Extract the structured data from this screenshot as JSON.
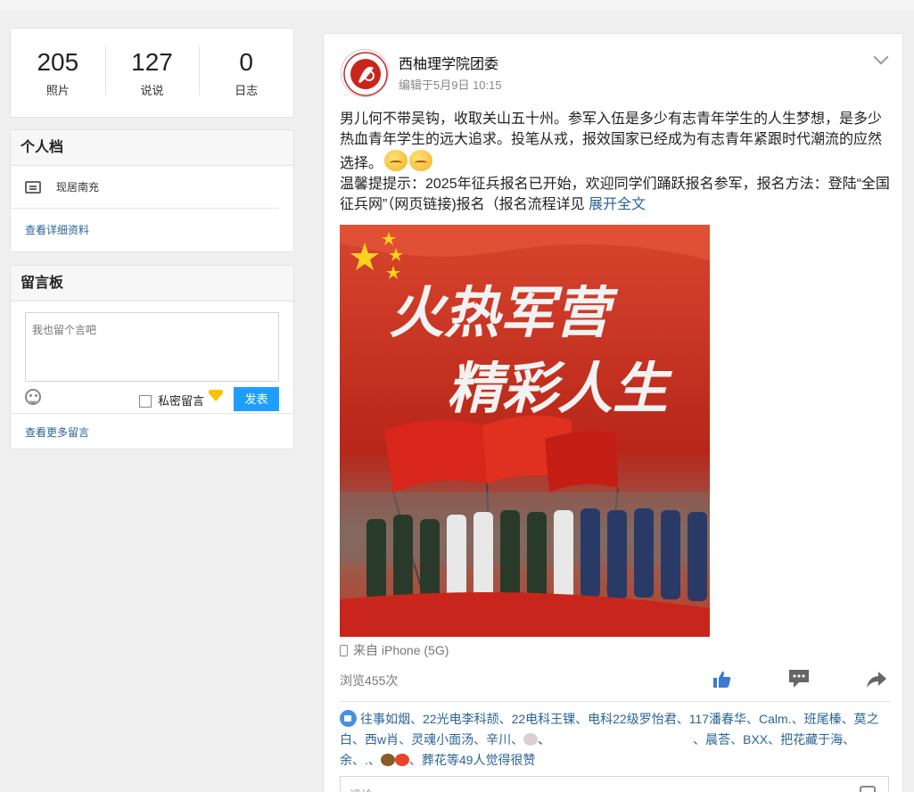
{
  "stats": [
    {
      "num": "205",
      "label": "照片"
    },
    {
      "num": "127",
      "label": "说说"
    },
    {
      "num": "0",
      "label": "日志"
    }
  ],
  "profile": {
    "title": "个人档",
    "residence": "现居南充",
    "details_link": "查看详细资料"
  },
  "guestbook": {
    "title": "留言板",
    "placeholder": "我也留个言吧",
    "secret_label": "私密留言",
    "post_button": "发表",
    "more_link": "查看更多留言"
  },
  "post": {
    "author": "西柚理学院团委",
    "meta": "编辑于5月9日 10:15",
    "text_1": "男儿何不带吴钩，收取关山五十州。参军入伍是多少有志青年学生的人生梦想，是多少热血青年学生的远大追求。投笔从戎，报效国家已经成为有志青年紧跟时代潮流的应然选择。",
    "text_2": "温馨提提示：2025年征兵报名已开始，欢迎同学们踊跃报名参军，报名方法：登陆“全国征兵网”（网页链接)报名（报名流程详见",
    "expand": "展开全文",
    "poster_line_1": "火热军营",
    "poster_line_2": "精彩人生",
    "device": "来自 iPhone (5G)",
    "views": "浏览455次",
    "likes_names": "往事如烟、22光电李科颉、22电科王锞、电科22级罗怡君、117潘春华、Calm.、班尾榛、莫之白、西w肖、灵魂小面汤、辛川、",
    "likes_names_2": "、晨荅、BXX、把花藏于海、余、.、",
    "likes_names_3": "、葬花等49人觉得很赞",
    "comment_placeholder": "评论"
  },
  "colors": {
    "accent": "#1e9fff",
    "link": "#2a6496",
    "poster_red": "#c8261c"
  }
}
